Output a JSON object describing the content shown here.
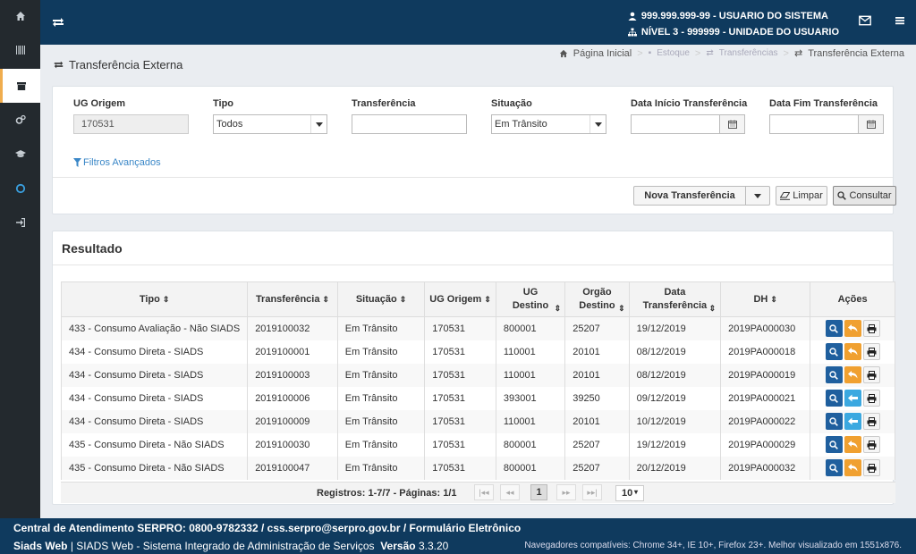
{
  "header": {
    "user_line": "999.999.999-99 - USUARIO DO SISTEMA",
    "unit_line": "NÍVEL 3 - 999999 - UNIDADE DO USUARIO"
  },
  "page": {
    "title": "Transferência Externa"
  },
  "breadcrumb": {
    "home": "Página Inicial",
    "estoque": "Estoque",
    "transferencias": "Transferências",
    "current": "Transferência Externa"
  },
  "filters": {
    "ug_origem_label": "UG Origem",
    "ug_origem_value": "170531",
    "tipo_label": "Tipo",
    "tipo_value": "Todos",
    "transferencia_label": "Transferência",
    "transferencia_value": "",
    "situacao_label": "Situação",
    "situacao_value": "Em Trânsito",
    "data_inicio_label": "Data Início Transferência",
    "data_inicio_value": "",
    "data_fim_label": "Data Fim Transferência",
    "data_fim_value": "",
    "advanced_link": "Filtros Avançados"
  },
  "buttons": {
    "nova": "Nova Transferência",
    "limpar": "Limpar",
    "consultar": "Consultar"
  },
  "result": {
    "title": "Resultado",
    "columns": [
      "Tipo",
      "Transferência",
      "Situação",
      "UG Origem",
      "UG Destino",
      "Orgão Destino",
      "Data Transferência",
      "DH",
      "Ações"
    ],
    "rows": [
      {
        "tipo": "433 - Consumo Avaliação - Não SIADS",
        "transferencia": "2019100032",
        "situacao": "Em Trânsito",
        "ug_origem": "170531",
        "ug_destino": "800001",
        "orgao_destino": "25207",
        "data": "19/12/2019",
        "dh": "2019PA000030",
        "action2": "reply"
      },
      {
        "tipo": "434 - Consumo Direta - SIADS",
        "transferencia": "2019100001",
        "situacao": "Em Trânsito",
        "ug_origem": "170531",
        "ug_destino": "110001",
        "orgao_destino": "20101",
        "data": "08/12/2019",
        "dh": "2019PA000018",
        "action2": "reply"
      },
      {
        "tipo": "434 - Consumo Direta - SIADS",
        "transferencia": "2019100003",
        "situacao": "Em Trânsito",
        "ug_origem": "170531",
        "ug_destino": "110001",
        "orgao_destino": "20101",
        "data": "08/12/2019",
        "dh": "2019PA000019",
        "action2": "reply"
      },
      {
        "tipo": "434 - Consumo Direta - SIADS",
        "transferencia": "2019100006",
        "situacao": "Em Trânsito",
        "ug_origem": "170531",
        "ug_destino": "393001",
        "orgao_destino": "39250",
        "data": "09/12/2019",
        "dh": "2019PA000021",
        "action2": "arrow-left"
      },
      {
        "tipo": "434 - Consumo Direta - SIADS",
        "transferencia": "2019100009",
        "situacao": "Em Trânsito",
        "ug_origem": "170531",
        "ug_destino": "110001",
        "orgao_destino": "20101",
        "data": "10/12/2019",
        "dh": "2019PA000022",
        "action2": "arrow-left"
      },
      {
        "tipo": "435 - Consumo Direta - Não SIADS",
        "transferencia": "2019100030",
        "situacao": "Em Trânsito",
        "ug_origem": "170531",
        "ug_destino": "800001",
        "orgao_destino": "25207",
        "data": "19/12/2019",
        "dh": "2019PA000029",
        "action2": "reply"
      },
      {
        "tipo": "435 - Consumo Direta - Não SIADS",
        "transferencia": "2019100047",
        "situacao": "Em Trânsito",
        "ug_origem": "170531",
        "ug_destino": "800001",
        "orgao_destino": "25207",
        "data": "20/12/2019",
        "dh": "2019PA000032",
        "action2": "reply"
      }
    ],
    "registros": "Registros: 1-7/7 - Páginas: 1/1",
    "current_page": "1",
    "page_size": "10"
  },
  "footer": {
    "line1": "Central de Atendimento SERPRO: 0800-9782332 / css.serpro@serpro.gov.br / Formulário Eletrônico",
    "app_name": "Siads Web",
    "app_desc": "| SIADS Web - Sistema Integrado de Administração de Serviços",
    "version_label": "Versão",
    "version": "3.3.20",
    "browsers": "Navegadores compatíveis: Chrome 34+, IE 10+, Firefox 23+. Melhor visualizado em 1551x876."
  },
  "colors": {
    "header_bg": "#0f3a5e",
    "sidebar_bg": "#23292e",
    "accent_orange": "#f0a030",
    "action_blue": "#1f5f9e",
    "link_blue": "#3a87c7"
  }
}
